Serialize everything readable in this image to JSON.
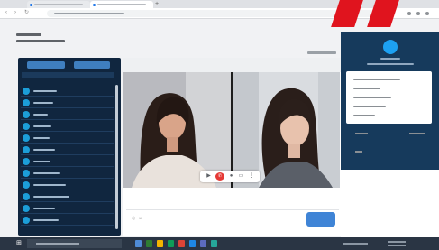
{
  "browser": {
    "tabs": [
      {
        "title": "",
        "active": false
      },
      {
        "title": "",
        "active": true
      }
    ],
    "new_tab_glyph": "+",
    "url": "",
    "icons": [
      "back-icon",
      "forward-icon",
      "reload-icon",
      "extensions-icon",
      "profile-icon",
      "menu-icon"
    ]
  },
  "page": {
    "title": "",
    "subtitle": "",
    "right_link": ""
  },
  "left_panel": {
    "buttons": [
      "",
      ""
    ],
    "search_placeholder": "",
    "items": [
      "",
      "",
      "",
      "",
      "",
      "",
      "",
      "",
      "",
      "",
      "",
      "",
      ""
    ]
  },
  "video": {
    "participants": 2,
    "controls_icons": [
      "video-icon",
      "end-call-icon",
      "screen-share-icon",
      "more-icon"
    ],
    "end_call_glyph": "✆"
  },
  "compose": {
    "placeholder": "",
    "send_label": ""
  },
  "right_panel": {
    "avatar_initial": "",
    "name": "",
    "email": "",
    "menu": [
      "",
      "",
      "",
      "",
      ""
    ],
    "sections": [
      "",
      ""
    ]
  },
  "taskbar": {
    "search_placeholder": "",
    "time": "",
    "date": ""
  },
  "colors": {
    "brand_red": "#e0141e",
    "panel_navy": "#10263f",
    "accent_blue": "#1c9ed8",
    "button_blue": "#3f84d6",
    "end_call_red": "#e53935"
  }
}
